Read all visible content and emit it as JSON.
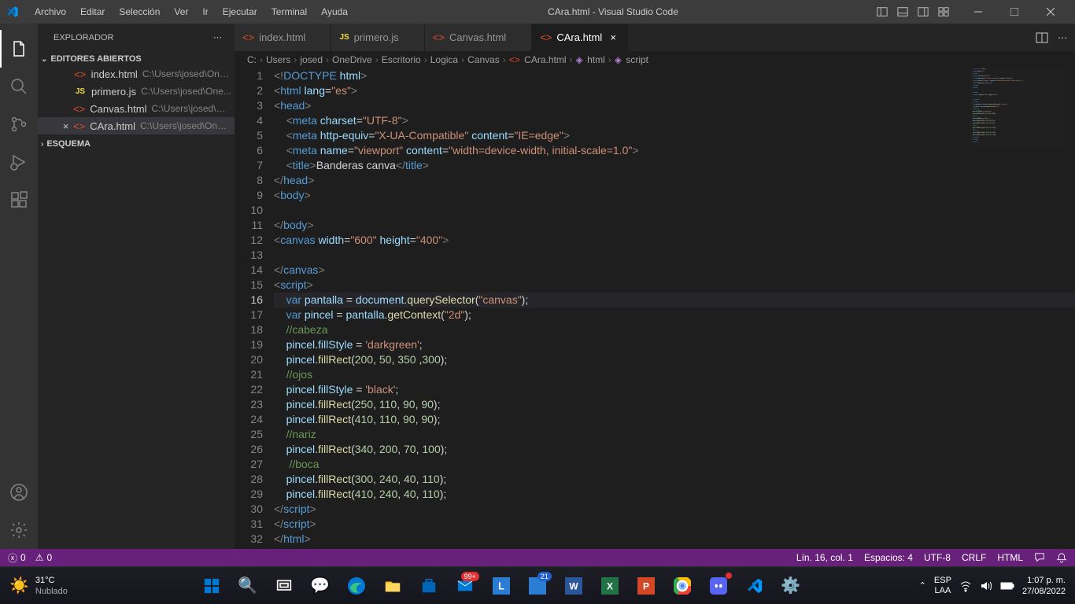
{
  "titlebar": {
    "menus": [
      "Archivo",
      "Editar",
      "Selección",
      "Ver",
      "Ir",
      "Ejecutar",
      "Terminal",
      "Ayuda"
    ],
    "title": "CAra.html - Visual Studio Code"
  },
  "sidebar": {
    "title": "EXPLORADOR",
    "sections": {
      "openEditors": {
        "label": "EDITORES ABIERTOS",
        "items": [
          {
            "icon": "html",
            "iconText": "<>",
            "name": "index.html",
            "path": "C:\\Users\\josed\\One..."
          },
          {
            "icon": "js",
            "iconText": "JS",
            "name": "primero.js",
            "path": "C:\\Users\\josed\\One..."
          },
          {
            "icon": "html",
            "iconText": "<>",
            "name": "Canvas.html",
            "path": "C:\\Users\\josed\\On..."
          },
          {
            "icon": "html",
            "iconText": "<>",
            "name": "CAra.html",
            "path": "C:\\Users\\josed\\OneD..."
          }
        ]
      },
      "outline": {
        "label": "ESQUEMA"
      }
    }
  },
  "tabs": [
    {
      "icon": "html",
      "iconText": "<>",
      "label": "index.html",
      "active": false
    },
    {
      "icon": "js",
      "iconText": "JS",
      "label": "primero.js",
      "active": false
    },
    {
      "icon": "html",
      "iconText": "<>",
      "label": "Canvas.html",
      "active": false
    },
    {
      "icon": "html",
      "iconText": "<>",
      "label": "CAra.html",
      "active": true
    }
  ],
  "breadcrumbs": [
    "C:",
    "Users",
    "josed",
    "OneDrive",
    "Escritorio",
    "Logica",
    "Canvas",
    "CAra.html",
    "html",
    "script"
  ],
  "code": {
    "currentLine": 16,
    "lines": [
      {
        "n": 1,
        "html": "<span class='c-gray'>&lt;!</span><span class='c-tag'>DOCTYPE</span> <span class='c-attr'>html</span><span class='c-gray'>&gt;</span>"
      },
      {
        "n": 2,
        "html": "<span class='c-gray'>&lt;</span><span class='c-tag'>html</span> <span class='c-attr'>lang</span><span class='c-text'>=</span><span class='c-str'>\"es\"</span><span class='c-gray'>&gt;</span>"
      },
      {
        "n": 3,
        "html": "<span class='c-gray'>&lt;</span><span class='c-tag'>head</span><span class='c-gray'>&gt;</span>"
      },
      {
        "n": 4,
        "html": "    <span class='c-gray'>&lt;</span><span class='c-tag'>meta</span> <span class='c-attr'>charset</span><span class='c-text'>=</span><span class='c-str'>\"UTF-8\"</span><span class='c-gray'>&gt;</span>"
      },
      {
        "n": 5,
        "html": "    <span class='c-gray'>&lt;</span><span class='c-tag'>meta</span> <span class='c-attr'>http-equiv</span><span class='c-text'>=</span><span class='c-str'>\"X-UA-Compatible\"</span> <span class='c-attr'>content</span><span class='c-text'>=</span><span class='c-str'>\"IE=edge\"</span><span class='c-gray'>&gt;</span>"
      },
      {
        "n": 6,
        "html": "    <span class='c-gray'>&lt;</span><span class='c-tag'>meta</span> <span class='c-attr'>name</span><span class='c-text'>=</span><span class='c-str'>\"viewport\"</span> <span class='c-attr'>content</span><span class='c-text'>=</span><span class='c-str'>\"width=device-width, initial-scale=1.0\"</span><span class='c-gray'>&gt;</span>"
      },
      {
        "n": 7,
        "html": "    <span class='c-gray'>&lt;</span><span class='c-tag'>title</span><span class='c-gray'>&gt;</span><span class='c-text'>Banderas canva</span><span class='c-gray'>&lt;/</span><span class='c-tag'>title</span><span class='c-gray'>&gt;</span>"
      },
      {
        "n": 8,
        "html": "<span class='c-gray'>&lt;/</span><span class='c-tag'>head</span><span class='c-gray'>&gt;</span>"
      },
      {
        "n": 9,
        "html": "<span class='c-gray'>&lt;</span><span class='c-tag'>body</span><span class='c-gray'>&gt;</span>"
      },
      {
        "n": 10,
        "html": ""
      },
      {
        "n": 11,
        "html": "<span class='c-gray'>&lt;/</span><span class='c-tag'>body</span><span class='c-gray'>&gt;</span>"
      },
      {
        "n": 12,
        "html": "<span class='c-gray'>&lt;</span><span class='c-tag'>canvas</span> <span class='c-attr'>width</span><span class='c-text'>=</span><span class='c-str'>\"600\"</span> <span class='c-attr'>height</span><span class='c-text'>=</span><span class='c-str'>\"400\"</span><span class='c-gray'>&gt;</span>"
      },
      {
        "n": 13,
        "html": ""
      },
      {
        "n": 14,
        "html": "<span class='c-gray'>&lt;/</span><span class='c-tag'>canvas</span><span class='c-gray'>&gt;</span>"
      },
      {
        "n": 15,
        "html": "<span class='c-gray'>&lt;</span><span class='c-tag'>script</span><span class='c-gray'>&gt;</span>"
      },
      {
        "n": 16,
        "html": "    <span class='c-kw'>var</span> <span class='c-var'>pantalla</span> <span class='c-text'>=</span> <span class='c-var'>document</span><span class='c-text'>.</span><span class='c-func'>querySelector</span><span class='c-text'>(</span><span class='c-str'>\"canvas\"</span><span class='c-text'>);</span>"
      },
      {
        "n": 17,
        "html": "    <span class='c-kw'>var</span> <span class='c-var'>pincel</span> <span class='c-text'>=</span> <span class='c-var'>pantalla</span><span class='c-text'>.</span><span class='c-func'>getContext</span><span class='c-text'>(</span><span class='c-str'>\"2d\"</span><span class='c-text'>);</span>"
      },
      {
        "n": 18,
        "html": "    <span class='c-cmt'>//cabeza</span>"
      },
      {
        "n": 19,
        "html": "    <span class='c-var'>pincel</span><span class='c-text'>.</span><span class='c-var'>fillStyle</span> <span class='c-text'>=</span> <span class='c-str'>'darkgreen'</span><span class='c-text'>;</span>"
      },
      {
        "n": 20,
        "html": "    <span class='c-var'>pincel</span><span class='c-text'>.</span><span class='c-func'>fillRect</span><span class='c-text'>(</span><span class='c-num'>200</span><span class='c-text'>, </span><span class='c-num'>50</span><span class='c-text'>, </span><span class='c-num'>350</span><span class='c-text'> ,</span><span class='c-num'>300</span><span class='c-text'>);</span>"
      },
      {
        "n": 21,
        "html": "    <span class='c-cmt'>//ojos</span>"
      },
      {
        "n": 22,
        "html": "    <span class='c-var'>pincel</span><span class='c-text'>.</span><span class='c-var'>fillStyle</span> <span class='c-text'>=</span> <span class='c-str'>'black'</span><span class='c-text'>;</span>"
      },
      {
        "n": 23,
        "html": "    <span class='c-var'>pincel</span><span class='c-text'>.</span><span class='c-func'>fillRect</span><span class='c-text'>(</span><span class='c-num'>250</span><span class='c-text'>, </span><span class='c-num'>110</span><span class='c-text'>, </span><span class='c-num'>90</span><span class='c-text'>, </span><span class='c-num'>90</span><span class='c-text'>);</span>"
      },
      {
        "n": 24,
        "html": "    <span class='c-var'>pincel</span><span class='c-text'>.</span><span class='c-func'>fillRect</span><span class='c-text'>(</span><span class='c-num'>410</span><span class='c-text'>, </span><span class='c-num'>110</span><span class='c-text'>, </span><span class='c-num'>90</span><span class='c-text'>, </span><span class='c-num'>90</span><span class='c-text'>);</span>"
      },
      {
        "n": 25,
        "html": "    <span class='c-cmt'>//nariz</span>"
      },
      {
        "n": 26,
        "html": "    <span class='c-var'>pincel</span><span class='c-text'>.</span><span class='c-func'>fillRect</span><span class='c-text'>(</span><span class='c-num'>340</span><span class='c-text'>, </span><span class='c-num'>200</span><span class='c-text'>, </span><span class='c-num'>70</span><span class='c-text'>, </span><span class='c-num'>100</span><span class='c-text'>);</span>"
      },
      {
        "n": 27,
        "html": "     <span class='c-cmt'>//boca</span>"
      },
      {
        "n": 28,
        "html": "    <span class='c-var'>pincel</span><span class='c-text'>.</span><span class='c-func'>fillRect</span><span class='c-text'>(</span><span class='c-num'>300</span><span class='c-text'>, </span><span class='c-num'>240</span><span class='c-text'>, </span><span class='c-num'>40</span><span class='c-text'>, </span><span class='c-num'>110</span><span class='c-text'>);</span>"
      },
      {
        "n": 29,
        "html": "    <span class='c-var'>pincel</span><span class='c-text'>.</span><span class='c-func'>fillRect</span><span class='c-text'>(</span><span class='c-num'>410</span><span class='c-text'>, </span><span class='c-num'>240</span><span class='c-text'>, </span><span class='c-num'>40</span><span class='c-text'>, </span><span class='c-num'>110</span><span class='c-text'>);</span>"
      },
      {
        "n": 30,
        "html": "<span class='c-gray'>&lt;/</span><span class='c-tag'>script</span><span class='c-gray'>&gt;</span>"
      },
      {
        "n": 31,
        "html": "<span class='c-gray'>&lt;/</span><span class='c-tag'>script</span><span class='c-gray'>&gt;</span>"
      },
      {
        "n": 32,
        "html": "<span class='c-gray'>&lt;/</span><span class='c-tag'>html</span><span class='c-gray'>&gt;</span>"
      }
    ]
  },
  "statusbar": {
    "errors": "0",
    "warnings": "0",
    "position": "Lín. 16, col. 1",
    "spaces": "Espacios: 4",
    "encoding": "UTF-8",
    "eol": "CRLF",
    "lang": "HTML"
  },
  "taskbar": {
    "temp": "31°C",
    "weather": "Nublado",
    "lang1": "ESP",
    "lang2": "LAA",
    "time": "1:07 p. m.",
    "date": "27/08/2022",
    "badge99": "99+",
    "badge21": "21"
  }
}
